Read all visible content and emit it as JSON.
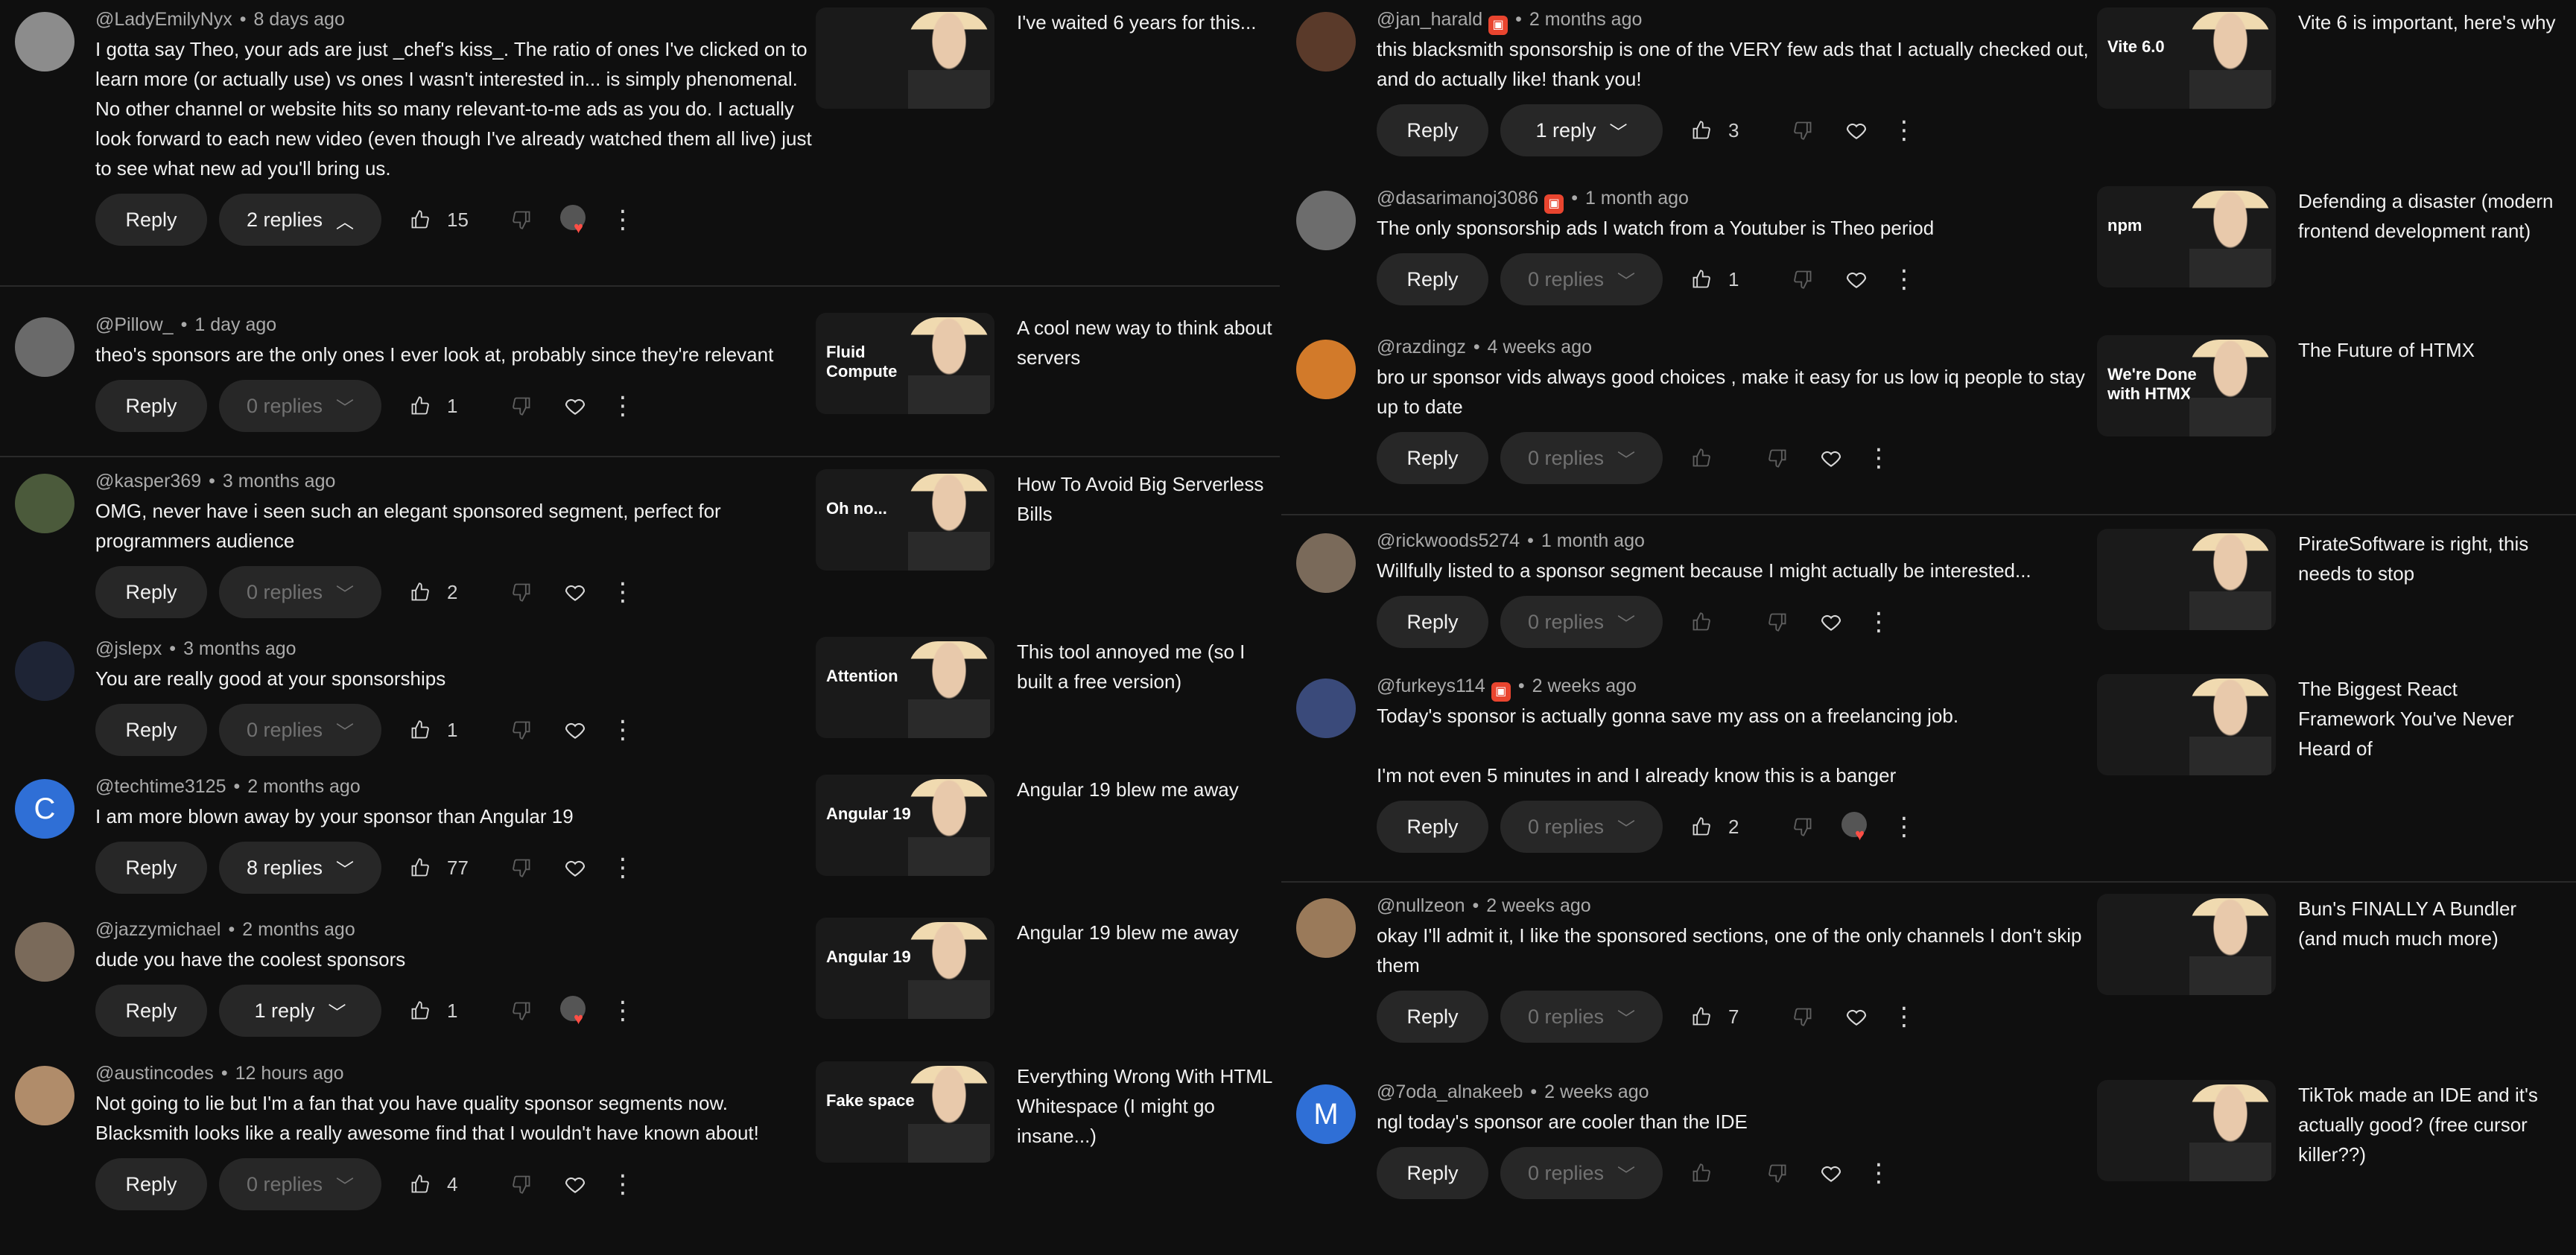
{
  "ui": {
    "reply_label": "Reply",
    "more_glyph": "⋮"
  },
  "left": [
    {
      "handle": "@LadyEmilyNyx",
      "time": "8 days ago",
      "badge": false,
      "text": "I gotta say Theo, your ads are just _chef's kiss_. The ratio of ones I've clicked on to learn more (or actually use) vs ones I wasn't interested in... is simply phenomenal. No other channel or website hits so many relevant-to-me ads as you do. I actually look forward to each new video (even though I've already watched them all live) just to see what new ad you'll bring us.",
      "replies": "2 replies",
      "replies_open": true,
      "likes": "15",
      "hearted": true,
      "video_title": "I've waited 6 years for this...",
      "thumb_text": "",
      "avatar_letter": "",
      "avatar_color": "#8c8c8c"
    },
    {
      "handle": "@Pillow_",
      "time": "1 day ago",
      "badge": false,
      "text": "theo's sponsors are the only ones I ever look at, probably since they're relevant",
      "replies": "0 replies",
      "replies_open": false,
      "likes": "1",
      "hearted": false,
      "video_title": "A cool new way to think about servers",
      "thumb_text": "Fluid Compute",
      "avatar_letter": "",
      "avatar_color": "#6a6a6a"
    },
    {
      "handle": "@kasper369",
      "time": "3 months ago",
      "badge": false,
      "text": "OMG, never have i seen such an elegant sponsored   segment, perfect for programmers audience",
      "replies": "0 replies",
      "replies_open": false,
      "likes": "2",
      "hearted": false,
      "video_title": "How To Avoid Big Serverless Bills",
      "thumb_text": "Oh no...",
      "avatar_letter": "",
      "avatar_color": "#4b5a3b"
    },
    {
      "handle": "@jslepx",
      "time": "3 months ago",
      "badge": false,
      "text": "You are really good at your sponsorships",
      "replies": "0 replies",
      "replies_open": false,
      "likes": "1",
      "hearted": false,
      "video_title": "This tool annoyed me (so I built a free version)",
      "thumb_text": "Attention",
      "avatar_letter": "",
      "avatar_color": "#1e2435"
    },
    {
      "handle": "@techtime3125",
      "time": "2 months ago",
      "badge": false,
      "text": "I am more blown away by your sponsor than Angular 19",
      "replies": "8 replies",
      "replies_open": false,
      "likes": "77",
      "hearted": false,
      "video_title": "Angular 19 blew me away",
      "thumb_text": "Angular 19",
      "avatar_letter": "C",
      "avatar_color": "#2f6fd6"
    },
    {
      "handle": "@jazzymichael",
      "time": "2 months ago",
      "badge": false,
      "text": "dude you have the coolest sponsors",
      "replies": "1 reply",
      "replies_open": false,
      "likes": "1",
      "hearted": true,
      "video_title": "Angular 19 blew me away",
      "thumb_text": "Angular 19",
      "avatar_letter": "",
      "avatar_color": "#7a6a5a"
    },
    {
      "handle": "@austincodes",
      "time": "12 hours ago",
      "badge": false,
      "text": "Not going to lie but I'm a fan that you have quality sponsor segments now. Blacksmith looks like a really awesome find that I wouldn't have known about!",
      "replies": "0 replies",
      "replies_open": false,
      "likes": "4",
      "hearted": false,
      "video_title": "Everything Wrong With HTML Whitespace (I might go insane...)",
      "thumb_text": "Fake space",
      "avatar_letter": "",
      "avatar_color": "#b08c6a"
    }
  ],
  "right": [
    {
      "handle": "@jan_harald",
      "time": "2 months ago",
      "badge": true,
      "text": "this blacksmith sponsorship is one of the VERY few ads that I actually checked out, and do actually like! thank you!",
      "replies": "1 reply",
      "replies_open": false,
      "likes": "3",
      "hearted": false,
      "video_title": "Vite 6 is important, here's why",
      "thumb_text": "Vite 6.0",
      "avatar_letter": "",
      "avatar_color": "#5a3a2a"
    },
    {
      "handle": "@dasarimanoj3086",
      "time": "1 month ago",
      "badge": true,
      "text": "The only sponsorship ads I watch from a Youtuber is Theo period",
      "replies": "0 replies",
      "replies_open": false,
      "likes": "1",
      "hearted": false,
      "video_title": "Defending a disaster (modern frontend development rant)",
      "thumb_text": "npm",
      "avatar_letter": "",
      "avatar_color": "#6d6d6d"
    },
    {
      "handle": "@razdingz",
      "time": "4 weeks ago",
      "badge": false,
      "text": "bro ur sponsor vids always good choices , make it easy for us low iq people to stay up to date",
      "replies": "0 replies",
      "replies_open": false,
      "likes": "",
      "hearted": false,
      "video_title": "The Future of HTMX",
      "thumb_text": "We're Done with HTMX",
      "avatar_letter": "",
      "avatar_color": "#d27a2a"
    },
    {
      "handle": "@rickwoods5274",
      "time": "1 month ago",
      "badge": false,
      "text": "Willfully listed to a sponsor segment because I might actually be interested...",
      "replies": "0 replies",
      "replies_open": false,
      "likes": "",
      "hearted": false,
      "video_title": "PirateSoftware is right, this needs to stop",
      "thumb_text": "",
      "avatar_letter": "",
      "avatar_color": "#7a6a5a"
    },
    {
      "handle": "@furkeys114",
      "time": "2 weeks ago",
      "badge": true,
      "text": "Today's sponsor is actually gonna save my ass on a freelancing job.\n\nI'm not even 5 minutes in and I already know this is a banger",
      "replies": "0 replies",
      "replies_open": false,
      "likes": "2",
      "hearted": true,
      "video_title": "The Biggest React Framework You've Never Heard of",
      "thumb_text": "",
      "avatar_letter": "",
      "avatar_color": "#3a4a7a"
    },
    {
      "handle": "@nullzeon",
      "time": "2 weeks ago",
      "badge": false,
      "text": "okay I'll admit it, I like the sponsored sections, one of the only channels I don't skip them",
      "replies": "0 replies",
      "replies_open": false,
      "likes": "7",
      "hearted": false,
      "video_title": "Bun's FINALLY A Bundler (and much much more)",
      "thumb_text": "",
      "avatar_letter": "",
      "avatar_color": "#9a7a5a"
    },
    {
      "handle": "@7oda_alnakeeb",
      "time": "2 weeks ago",
      "badge": false,
      "text": "ngl today's sponsor are cooler than the IDE",
      "replies": "0 replies",
      "replies_open": false,
      "likes": "",
      "hearted": false,
      "video_title": "TikTok made an IDE and it's actually good? (free cursor killer??)",
      "thumb_text": "",
      "avatar_letter": "M",
      "avatar_color": "#2f6fd6"
    }
  ]
}
